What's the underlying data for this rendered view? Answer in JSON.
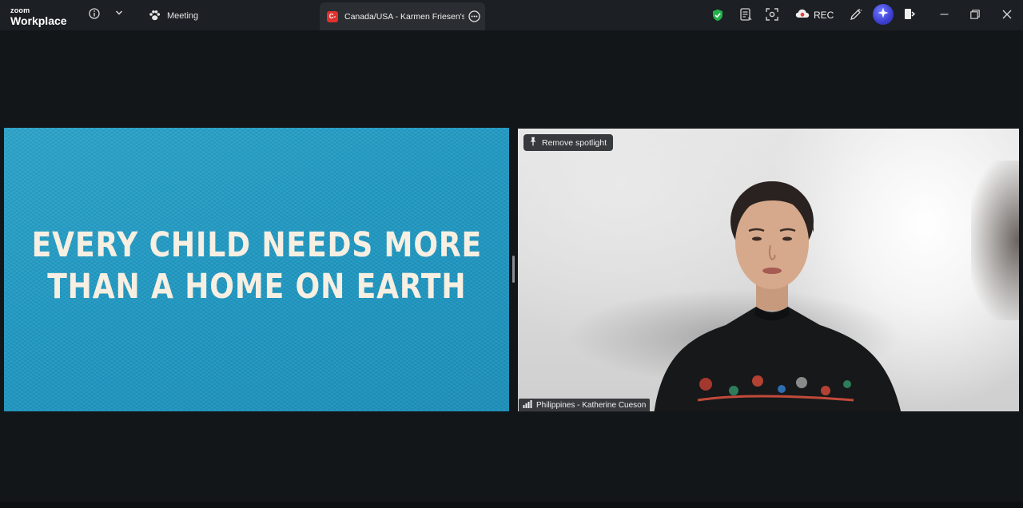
{
  "app": {
    "brand_top": "zoom",
    "brand_bottom": "Workplace"
  },
  "titlebar": {
    "meeting_label": "Meeting",
    "share_tab_title": "Canada/USA - Karmen Friesen's screen",
    "share_badge": "C-",
    "rec_label": "REC"
  },
  "share": {
    "line1": "EVERY CHILD NEEDS MORE",
    "line2": "THAN A HOME ON EARTH"
  },
  "video": {
    "spotlight_label": "Remove spotlight",
    "participant_name": "Philippines - Katherine Cueson"
  },
  "colors": {
    "security_green": "#22b14c",
    "rec_red": "#e8413c",
    "share_bg": "#1f98c2",
    "accent_ai": "#4b4fe0"
  },
  "icons": [
    "info-icon",
    "chevron-down-icon",
    "participants-paw-icon",
    "more-options-icon",
    "shield-check-icon",
    "notes-icon",
    "apps-icon",
    "cloud-record-icon",
    "whiteboard-pen-icon",
    "ai-companion-icon",
    "leave-icon",
    "minimize-icon",
    "restore-icon",
    "close-icon",
    "pin-icon",
    "signal-bars-icon"
  ]
}
